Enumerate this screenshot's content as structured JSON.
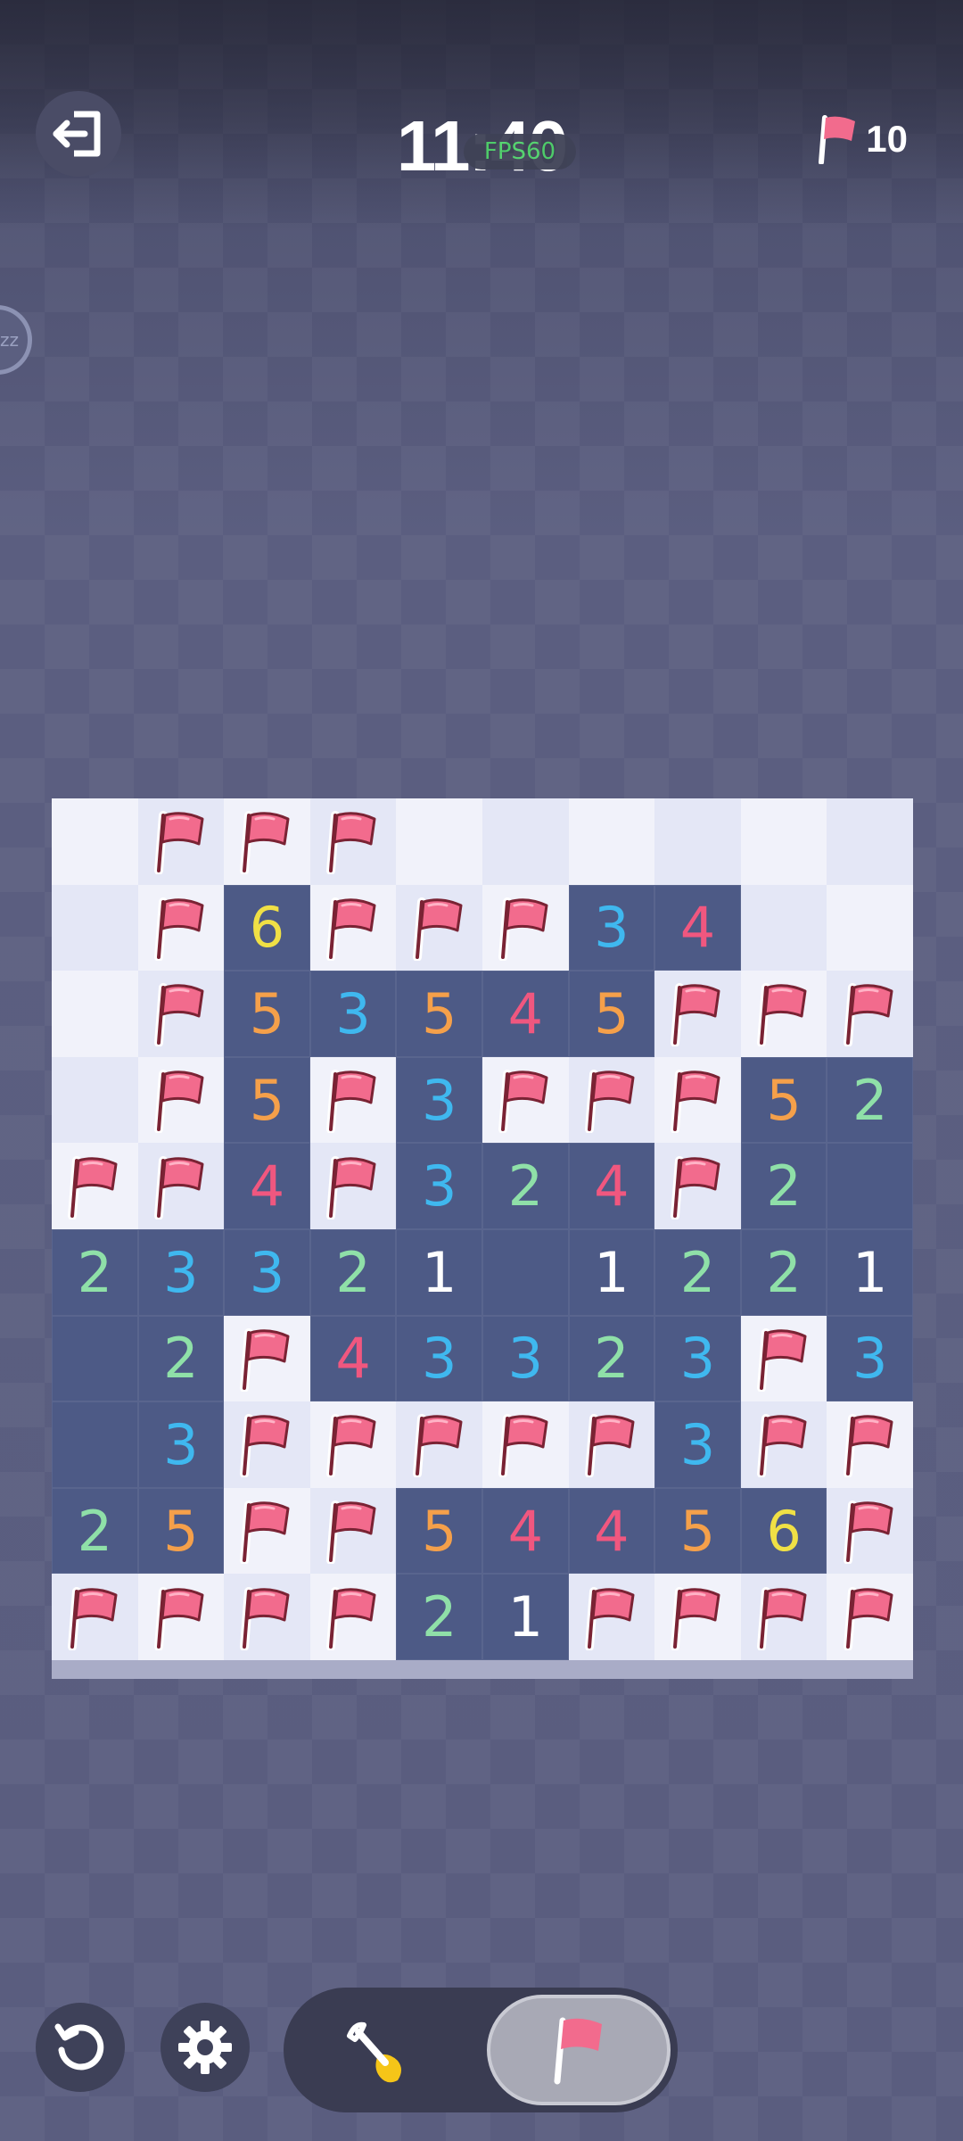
{
  "header": {
    "timer": "11:40",
    "fps": "FPS60",
    "flags_remaining": "10"
  },
  "side_bubble": {
    "label": "zz"
  },
  "board": {
    "rows": 10,
    "cols": 10,
    "cells": [
      [
        "",
        "F",
        "F",
        "F",
        "",
        "",
        "",
        "",
        "",
        ""
      ],
      [
        "",
        "F",
        "6",
        "F",
        "F",
        "F",
        "3",
        "4",
        "",
        ""
      ],
      [
        "",
        "F",
        "5",
        "3",
        "5",
        "4",
        "5",
        "F",
        "F",
        "F"
      ],
      [
        "",
        "F",
        "5",
        "F",
        "3",
        "F",
        "F",
        "F",
        "5",
        "2"
      ],
      [
        "F",
        "F",
        "4",
        "F",
        "3",
        "2",
        "4",
        "F",
        "2",
        "0"
      ],
      [
        "2",
        "3",
        "3",
        "2",
        "1",
        "0",
        "1",
        "2",
        "2",
        "1"
      ],
      [
        "0",
        "2",
        "F",
        "4",
        "3",
        "3",
        "2",
        "3",
        "F",
        "3"
      ],
      [
        "0",
        "3",
        "F",
        "F",
        "F",
        "F",
        "F",
        "3",
        "F",
        "F"
      ],
      [
        "2",
        "5",
        "F",
        "F",
        "5",
        "4",
        "4",
        "5",
        "6",
        "F"
      ],
      [
        "F",
        "F",
        "F",
        "F",
        "2",
        "1",
        "F",
        "F",
        "F",
        "F"
      ]
    ],
    "number_colors": {
      "1": "#ffffff",
      "2": "#8fe0a8",
      "3": "#3fb8ef",
      "4": "#f0577f",
      "5": "#f5a04a",
      "6": "#f0e045"
    },
    "flag_color": "#f26b8d"
  },
  "controls": {
    "restart_icon": "restart-icon",
    "settings_icon": "gear-icon",
    "dig_icon": "shovel-icon",
    "flag_icon": "flag-icon",
    "active_mode": "flag"
  }
}
